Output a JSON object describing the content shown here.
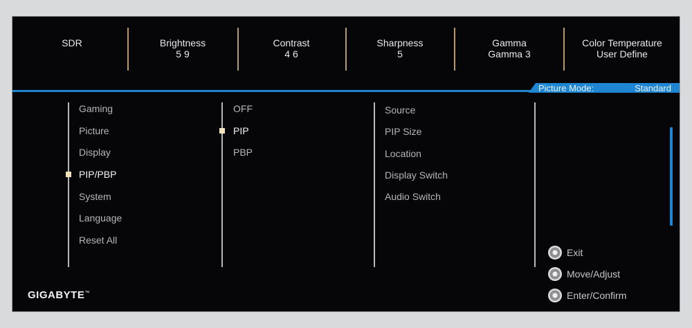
{
  "top_bar": {
    "mode": "SDR",
    "brightness": {
      "label": "Brightness",
      "value": "5 9"
    },
    "contrast": {
      "label": "Contrast",
      "value": "4 6"
    },
    "sharpness": {
      "label": "Sharpness",
      "value": "5"
    },
    "gamma": {
      "label": "Gamma",
      "value": "Gamma 3"
    },
    "color_temp": {
      "label": "Color Temperature",
      "value": "User Define"
    }
  },
  "picture_mode": {
    "label": "Picture Mode:",
    "value": "Standard"
  },
  "main_menu": {
    "items": [
      "Gaming",
      "Picture",
      "Display",
      "PIP/PBP",
      "System",
      "Language",
      "Reset All"
    ],
    "selected": "PIP/PBP"
  },
  "sub_menu": {
    "items": [
      "OFF",
      "PIP",
      "PBP"
    ],
    "selected": "PIP"
  },
  "options_menu": {
    "items": [
      "Source",
      "PIP Size",
      "Location",
      "Display Switch",
      "Audio Switch"
    ]
  },
  "legend": {
    "exit": "Exit",
    "move": "Move/Adjust",
    "enter": "Enter/Confirm"
  },
  "brand": "GIGABYTE",
  "brand_mark": "™",
  "colors": {
    "accent": "#1e86d2",
    "background": "#060608",
    "separator": "#b69a6e"
  },
  "icons": [
    "joystick-icon"
  ]
}
